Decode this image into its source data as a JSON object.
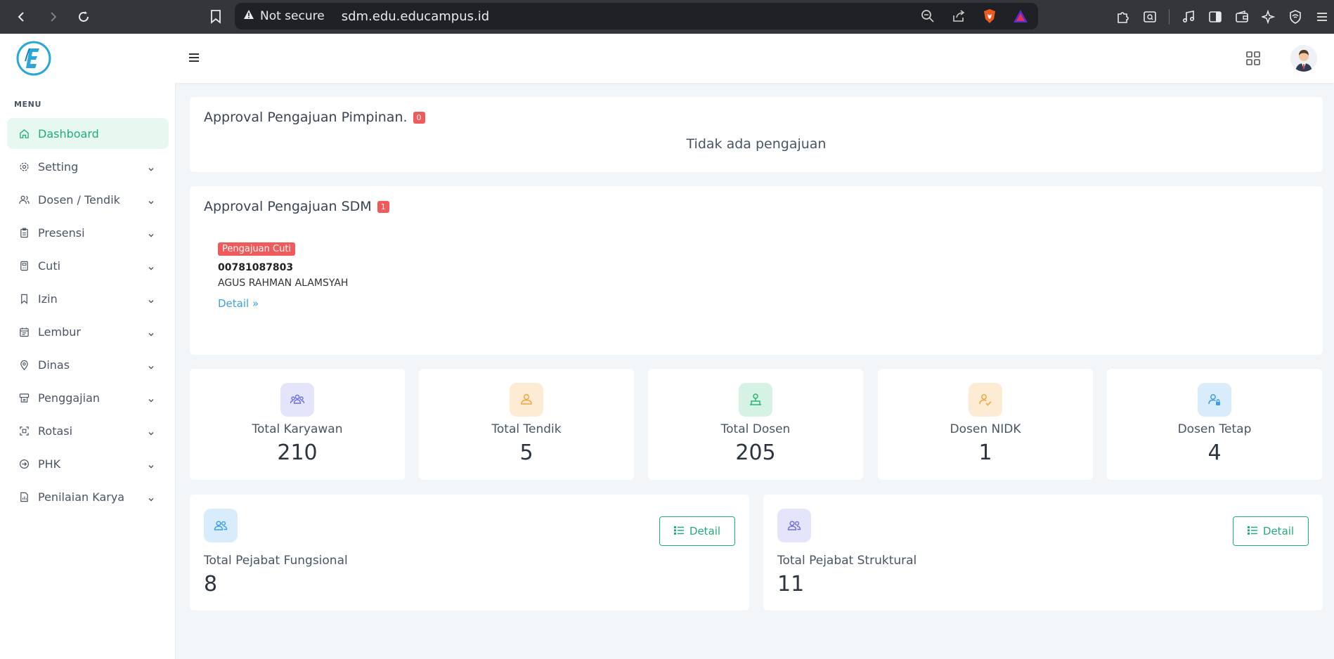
{
  "browser": {
    "security_label": "Not secure",
    "url": "sdm.edu.educampus.id"
  },
  "sidebar": {
    "menu_title": "MENU",
    "items": [
      {
        "label": "Dashboard",
        "icon": "home-icon"
      },
      {
        "label": "Setting",
        "icon": "gear-icon"
      },
      {
        "label": "Dosen / Tendik",
        "icon": "users-icon"
      },
      {
        "label": "Presensi",
        "icon": "clipboard-icon"
      },
      {
        "label": "Cuti",
        "icon": "calculator-icon"
      },
      {
        "label": "Izin",
        "icon": "bookmark-icon"
      },
      {
        "label": "Lembur",
        "icon": "calendar-icon"
      },
      {
        "label": "Dinas",
        "icon": "map-pin-icon"
      },
      {
        "label": "Penggajian",
        "icon": "payroll-icon"
      },
      {
        "label": "Rotasi",
        "icon": "rotate-icon"
      },
      {
        "label": "PHK",
        "icon": "exit-icon"
      },
      {
        "label": "Penilaian Karya",
        "icon": "file-chart-icon"
      }
    ]
  },
  "approval_pimpinan": {
    "title": "Approval Pengajuan Pimpinan.",
    "count": "0",
    "empty_text": "Tidak ada pengajuan"
  },
  "approval_sdm": {
    "title": "Approval Pengajuan SDM",
    "count": "1",
    "request": {
      "type": "Pengajuan Cuti",
      "nip": "00781087803",
      "name": "AGUS RAHMAN ALAMSYAH",
      "detail_label": "Detail »"
    }
  },
  "stats": [
    {
      "label": "Total Karyawan",
      "value": "210",
      "color": "#6e6fe0",
      "bg": "#e4e5fb"
    },
    {
      "label": "Total Tendik",
      "value": "5",
      "color": "#f2a53c",
      "bg": "#fdebd3"
    },
    {
      "label": "Total Dosen",
      "value": "205",
      "color": "#2bb673",
      "bg": "#d5f2e4"
    },
    {
      "label": "Dosen NIDK",
      "value": "1",
      "color": "#f2a53c",
      "bg": "#fdebd3"
    },
    {
      "label": "Dosen Tetap",
      "value": "4",
      "color": "#3b9eea",
      "bg": "#d8ecfb"
    }
  ],
  "pejabat": [
    {
      "label": "Total Pejabat Fungsional",
      "value": "8",
      "detail_label": "Detail"
    },
    {
      "label": "Total Pejabat Struktural",
      "value": "11",
      "detail_label": "Detail"
    }
  ],
  "colors": {
    "accent": "#1fae77",
    "danger": "#f05a5a",
    "link": "#3b9eea"
  }
}
